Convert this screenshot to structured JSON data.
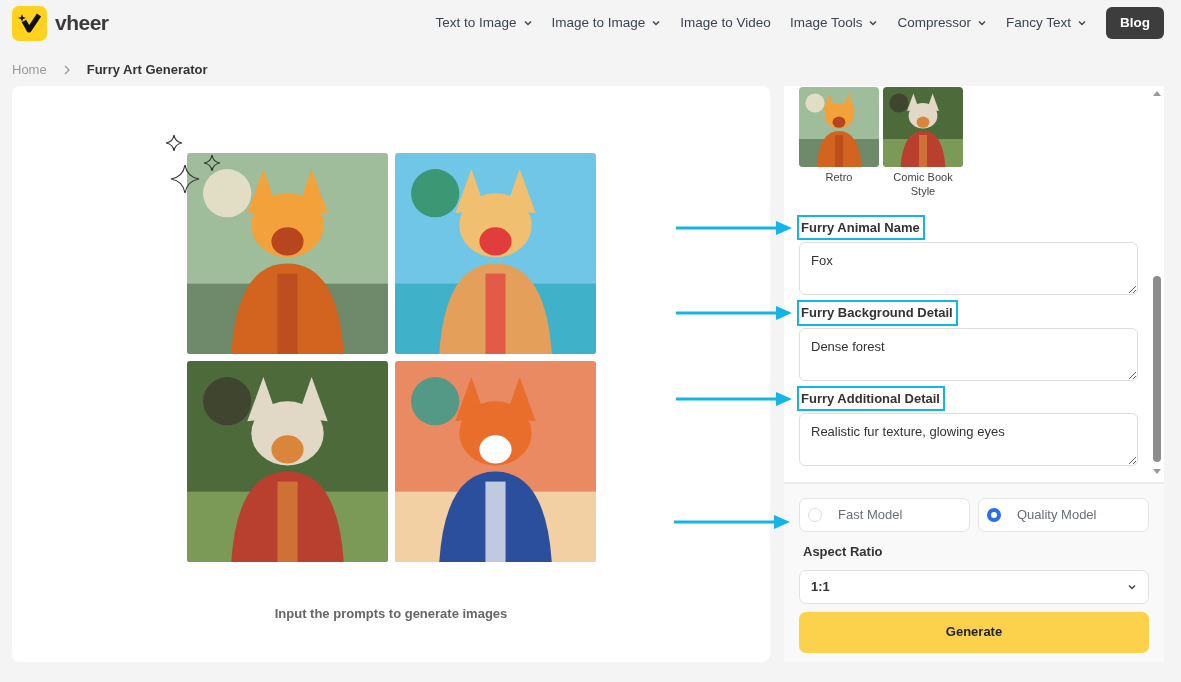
{
  "header": {
    "logo_text": "vheer",
    "nav": [
      {
        "label": "Text to Image",
        "dropdown": true
      },
      {
        "label": "Image to Image",
        "dropdown": true
      },
      {
        "label": "Image to Video",
        "dropdown": false
      },
      {
        "label": "Image Tools",
        "dropdown": true
      },
      {
        "label": "Compressor",
        "dropdown": true
      },
      {
        "label": "Fancy Text",
        "dropdown": true
      }
    ],
    "blog_button": "Blog"
  },
  "breadcrumb": [
    {
      "label": "Home",
      "current": false
    },
    {
      "label": "Furry Art Generator",
      "current": true
    }
  ],
  "preview": {
    "caption": "Input the prompts to generate images"
  },
  "styles": [
    {
      "label": "Retro",
      "selected": false
    },
    {
      "label": "Comic Book Style",
      "selected": false
    }
  ],
  "fields": [
    {
      "label": "Furry Animal Name",
      "value": "Fox",
      "highlighted": true
    },
    {
      "label": "Furry Background Detail",
      "value": "Dense forest",
      "highlighted": true
    },
    {
      "label": "Furry Additional Detail",
      "value": "Realistic fur texture, glowing eyes",
      "highlighted": true
    }
  ],
  "models": [
    {
      "label": "Fast Model",
      "selected": false
    },
    {
      "label": "Quality Model",
      "selected": true
    }
  ],
  "models_highlighted": true,
  "aspect_ratio": {
    "label": "Aspect Ratio",
    "value": "1:1"
  },
  "generate_button": "Generate"
}
